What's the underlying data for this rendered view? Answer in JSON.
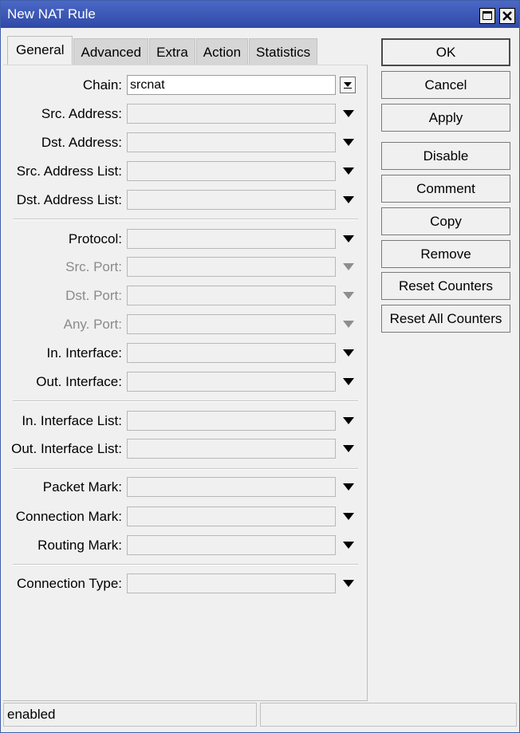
{
  "window": {
    "title": "New NAT Rule"
  },
  "tabs": [
    "General",
    "Advanced",
    "Extra",
    "Action",
    "Statistics"
  ],
  "fields": {
    "chain": {
      "label": "Chain:",
      "value": "srcnat"
    },
    "src_address": {
      "label": "Src. Address:",
      "value": ""
    },
    "dst_address": {
      "label": "Dst. Address:",
      "value": ""
    },
    "src_address_list": {
      "label": "Src. Address List:",
      "value": ""
    },
    "dst_address_list": {
      "label": "Dst. Address List:",
      "value": ""
    },
    "protocol": {
      "label": "Protocol:",
      "value": ""
    },
    "src_port": {
      "label": "Src. Port:",
      "value": ""
    },
    "dst_port": {
      "label": "Dst. Port:",
      "value": ""
    },
    "any_port": {
      "label": "Any. Port:",
      "value": ""
    },
    "in_interface": {
      "label": "In. Interface:",
      "value": ""
    },
    "out_interface": {
      "label": "Out. Interface:",
      "value": ""
    },
    "in_interface_list": {
      "label": "In. Interface List:",
      "value": ""
    },
    "out_interface_list": {
      "label": "Out. Interface List:",
      "value": ""
    },
    "packet_mark": {
      "label": "Packet Mark:",
      "value": ""
    },
    "connection_mark": {
      "label": "Connection Mark:",
      "value": ""
    },
    "routing_mark": {
      "label": "Routing Mark:",
      "value": ""
    },
    "connection_type": {
      "label": "Connection Type:",
      "value": ""
    }
  },
  "buttons": {
    "ok": "OK",
    "cancel": "Cancel",
    "apply": "Apply",
    "disable": "Disable",
    "comment": "Comment",
    "copy": "Copy",
    "remove": "Remove",
    "reset_counters": "Reset Counters",
    "reset_all_counters": "Reset All Counters"
  },
  "status": {
    "left": "enabled",
    "right": ""
  },
  "colors": {
    "titlebar": "#3553b5",
    "background": "#f0f0f0"
  }
}
